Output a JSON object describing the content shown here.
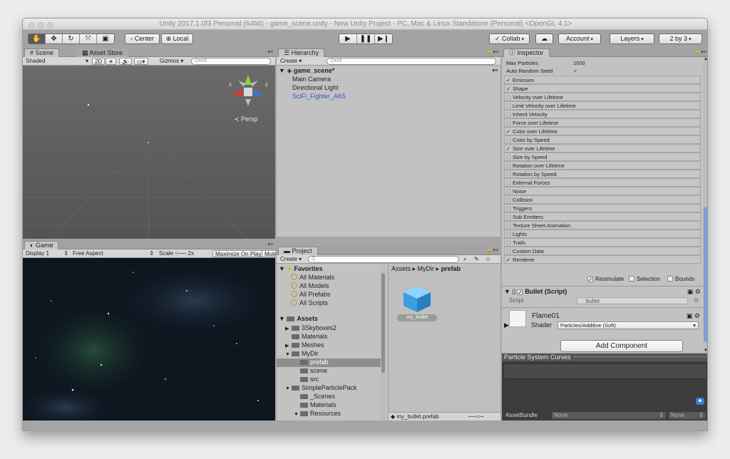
{
  "window": {
    "title": "Unity 2017.1.0f3 Personal (64bit) - game_scene.unity - New Unity Project - PC, Mac & Linux Standalone (Personal) <OpenGL 4.1>"
  },
  "toolbar": {
    "tools": [
      {
        "icon": "hand-icon",
        "glyph": "✋"
      },
      {
        "icon": "move-icon",
        "glyph": "✥"
      },
      {
        "icon": "rotate-icon",
        "glyph": "↻"
      },
      {
        "icon": "scale-icon",
        "glyph": "⤧"
      },
      {
        "icon": "rect-tool-icon",
        "glyph": "▣"
      }
    ],
    "pivot_label": "Center",
    "space_label": "Local",
    "collab_label": "Collab",
    "account_label": "Account",
    "layers_label": "Layers",
    "layout_label": "2 by 3"
  },
  "scene": {
    "tab_label": "Scene",
    "asset_store_label": "Asset Store",
    "shading": "Shaded",
    "mode_2d": "2D",
    "gizmos_label": "Gizmos",
    "search_placeholder": "Q▾All",
    "persp_label": "Persp",
    "axis_x": "x",
    "axis_z": "z"
  },
  "game": {
    "tab_label": "Game",
    "display": "Display 1",
    "aspect": "Free Aspect",
    "scale_label": "Scale",
    "scale_value": "2x",
    "maximize_label": "Maximize On Play",
    "mute_label": "Mute"
  },
  "hierarchy": {
    "tab_label": "Hierarchy",
    "create_label": "Create",
    "search_placeholder": "Q▾All",
    "scene_name": "game_scene*",
    "items": [
      "Main Camera",
      "Directional Light",
      "SciFi_Fighter_AK5"
    ]
  },
  "project": {
    "tab_label": "Project",
    "create_label": "Create",
    "favorites_label": "Favorites",
    "favorites": [
      "All Materials",
      "All Models",
      "All Prefabs",
      "All Scripts"
    ],
    "assets_label": "Assets",
    "tree": [
      {
        "label": "3Skyboxes2",
        "depth": 1,
        "arrow": "▶"
      },
      {
        "label": "Materials",
        "depth": 1,
        "arrow": ""
      },
      {
        "label": "Meshes",
        "depth": 1,
        "arrow": "▶"
      },
      {
        "label": "MyDir",
        "depth": 1,
        "arrow": "▼"
      },
      {
        "label": "prefab",
        "depth": 2,
        "arrow": "",
        "selected": true
      },
      {
        "label": "scene",
        "depth": 2,
        "arrow": ""
      },
      {
        "label": "src",
        "depth": 2,
        "arrow": ""
      },
      {
        "label": "SimpleParticlePack",
        "depth": 1,
        "arrow": "▼"
      },
      {
        "label": "_Scenes",
        "depth": 2,
        "arrow": ""
      },
      {
        "label": "Materials",
        "depth": 2,
        "arrow": ""
      },
      {
        "label": "Resources",
        "depth": 2,
        "arrow": "▼"
      }
    ],
    "breadcrumb": [
      "Assets",
      "MyDir",
      "prefab"
    ],
    "asset_name": "my_bullet",
    "status_file": "my_bullet.prefab"
  },
  "inspector": {
    "tab_label": "Inspector",
    "max_particles_label": "Max Particles",
    "max_particles_value": "1000",
    "auto_random_seed_label": "Auto Random Seed",
    "modules": [
      {
        "label": "Emission",
        "checked": true
      },
      {
        "label": "Shape",
        "checked": true
      },
      {
        "label": "Velocity over Lifetime",
        "checked": false
      },
      {
        "label": "Limit Velocity over Lifetime",
        "checked": false
      },
      {
        "label": "Inherit Velocity",
        "checked": false
      },
      {
        "label": "Force over Lifetime",
        "checked": false
      },
      {
        "label": "Color over Lifetime",
        "checked": true
      },
      {
        "label": "Color by Speed",
        "checked": false
      },
      {
        "label": "Size over Lifetime",
        "checked": true
      },
      {
        "label": "Size by Speed",
        "checked": false
      },
      {
        "label": "Rotation over Lifetime",
        "checked": false
      },
      {
        "label": "Rotation by Speed",
        "checked": false
      },
      {
        "label": "External Forces",
        "checked": false
      },
      {
        "label": "Noise",
        "checked": false
      },
      {
        "label": "Collision",
        "checked": false
      },
      {
        "label": "Triggers",
        "checked": false
      },
      {
        "label": "Sub Emitters",
        "checked": false
      },
      {
        "label": "Texture Sheet Animation",
        "checked": false
      },
      {
        "label": "Lights",
        "checked": false
      },
      {
        "label": "Trails",
        "checked": false
      },
      {
        "label": "Custom Data",
        "checked": false
      },
      {
        "label": "Renderer",
        "checked": true
      }
    ],
    "resimulate_label": "Resimulate",
    "selection_label": "Selection",
    "bounds_label": "Bounds",
    "component_name": "Bullet (Script)",
    "script_label": "Script",
    "script_value": "bullet",
    "material_name": "Flame01",
    "shader_label": "Shader",
    "shader_value": "Particles/Additive (Soft)",
    "add_component_label": "Add Component",
    "curves_label": "Particle System Curves",
    "assetbundle_label": "AssetBundle",
    "assetbundle_value": "None",
    "assetbundle_variant": "None"
  }
}
